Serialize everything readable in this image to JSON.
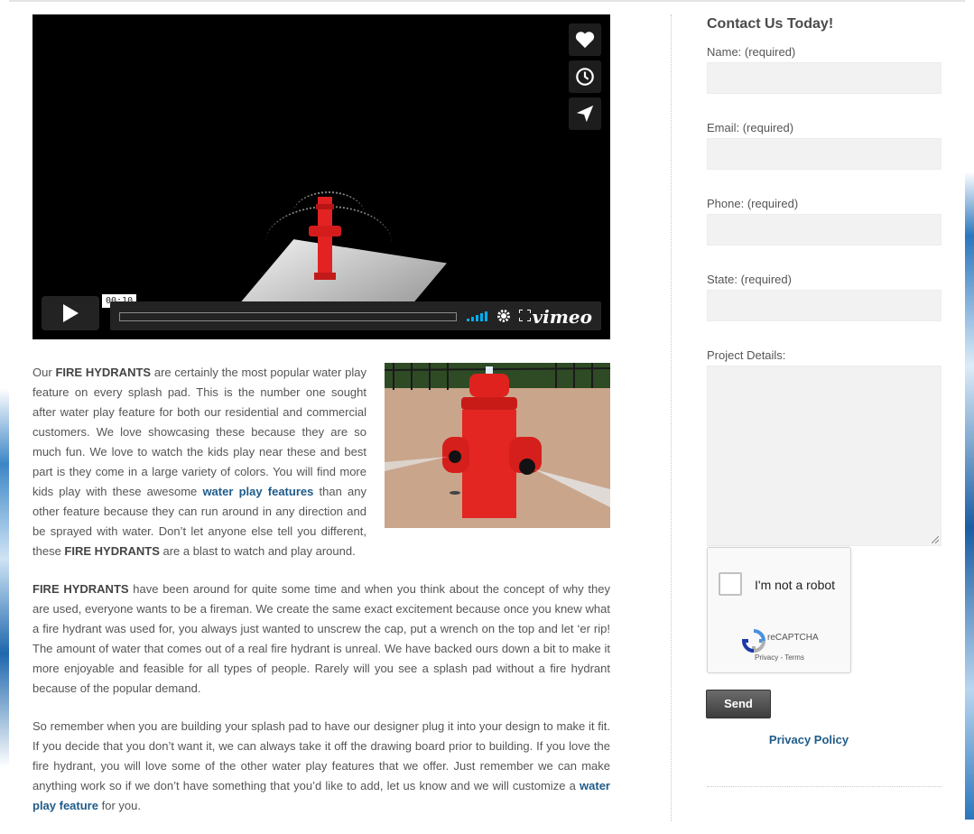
{
  "video": {
    "timecode": "00:10",
    "brand": "vimeo",
    "side_buttons": [
      "heart-icon",
      "clock-icon",
      "send-icon"
    ]
  },
  "article": {
    "p1": {
      "t1": "Our ",
      "b1": "FIRE HYDRANTS",
      "t2": " are certainly the most popular water play feature on every splash pad.  This is the number one sought after water play feature for both our residential and commercial customers.  We love showcasing these because they are so much fun.  We love to watch the kids play near these and best part is they come in a large variety of colors.  You will find more kids play with these awesome ",
      "link": "water play features",
      "t3": " than any other feature because they can run around in any direction and be sprayed with water.  Don’t let anyone else tell you different, these ",
      "b2": "FIRE HYDRANTS",
      "t4": " are a blast to watch and play around."
    },
    "p2": {
      "b1": "FIRE HYDRANTS",
      "t1": " have been around for quite some time and when you think about the concept of why they are used, everyone wants to be a fireman.  We create the same exact excitement because once you knew what a fire hydrant was used for, you always just wanted to unscrew the cap, put a wrench on the top and let ‘er rip!  The amount of water that comes out of a real fire hydrant is unreal.  We have backed ours down a bit to make it more enjoyable and feasible for all types of people. Rarely will you see a splash pad without a fire hydrant because of the popular demand."
    },
    "p3": {
      "t1": "So remember when you are building your splash pad to have our designer plug it into your design to make it fit.  If you decide that you don’t want it, we can always take it off the drawing board prior to building.  If you love the fire hydrant, you will love some of the other water play features that we offer.  Just remember we can make anything work so if we don’t have something that you’d like to add, let us know and we will customize a ",
      "link": "water play feature",
      "t2": " for you."
    }
  },
  "sidebar": {
    "title": "Contact Us Today!",
    "fields": {
      "name": "Name: (required)",
      "email": "Email: (required)",
      "phone": "Phone: (required)",
      "state": "State: (required)",
      "details": "Project Details:"
    },
    "recaptcha": {
      "label": "I'm not a robot",
      "brand": "reCAPTCHA",
      "links": "Privacy - Terms"
    },
    "send_label": "Send",
    "privacy_link": "Privacy Policy"
  },
  "colors": {
    "link": "#1f5b8a",
    "field_bg": "#f2f2f2",
    "vimeo_accent": "#00adef"
  }
}
